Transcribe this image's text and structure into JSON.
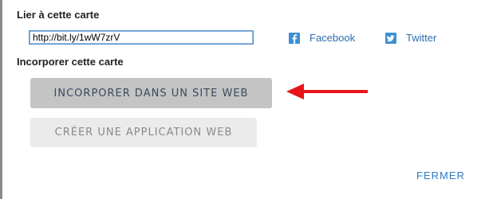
{
  "link_section": {
    "title": "Lier à cette carte",
    "url_value": "http://bit.ly/1wW7zrV"
  },
  "share": {
    "facebook_label": "Facebook",
    "facebook_icon": "facebook-icon",
    "twitter_label": "Twitter",
    "twitter_icon": "twitter-icon",
    "icon_color": "#3b8fd4"
  },
  "embed_section": {
    "title": "Incorporer cette carte",
    "embed_button_label": "INCORPORER DANS UN SITE WEB",
    "create_app_button_label": "CRÉER UNE APPLICATION WEB"
  },
  "annotation": {
    "arrow_icon": "red-arrow-left-icon",
    "arrow_color": "#e8141b"
  },
  "footer": {
    "close_label": "FERMER"
  }
}
